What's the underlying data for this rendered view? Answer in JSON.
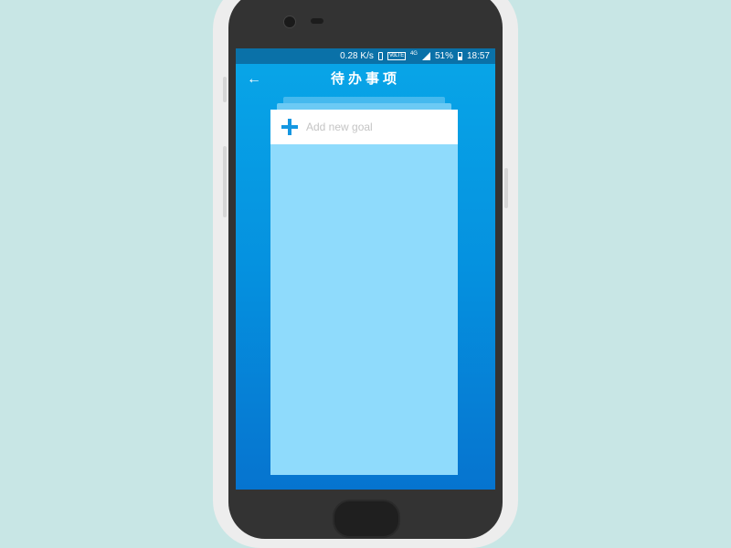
{
  "status_bar": {
    "network_speed": "0.28 K/s",
    "volte_label": "VoLTE",
    "network_type": "4G",
    "battery_percent": "51%",
    "time": "18:57"
  },
  "header": {
    "back_icon": "arrow-left-icon",
    "title": "待办事项"
  },
  "goal_card": {
    "add_icon": "plus-icon",
    "input_placeholder": "Add new goal",
    "input_value": ""
  },
  "colors": {
    "background": "#c8e6e5",
    "status_bar": "#0a71a8",
    "screen_gradient_top": "#08a6e8",
    "screen_gradient_bottom": "#0674cf",
    "card_body": "#8fdbfc",
    "accent": "#1597e1"
  }
}
